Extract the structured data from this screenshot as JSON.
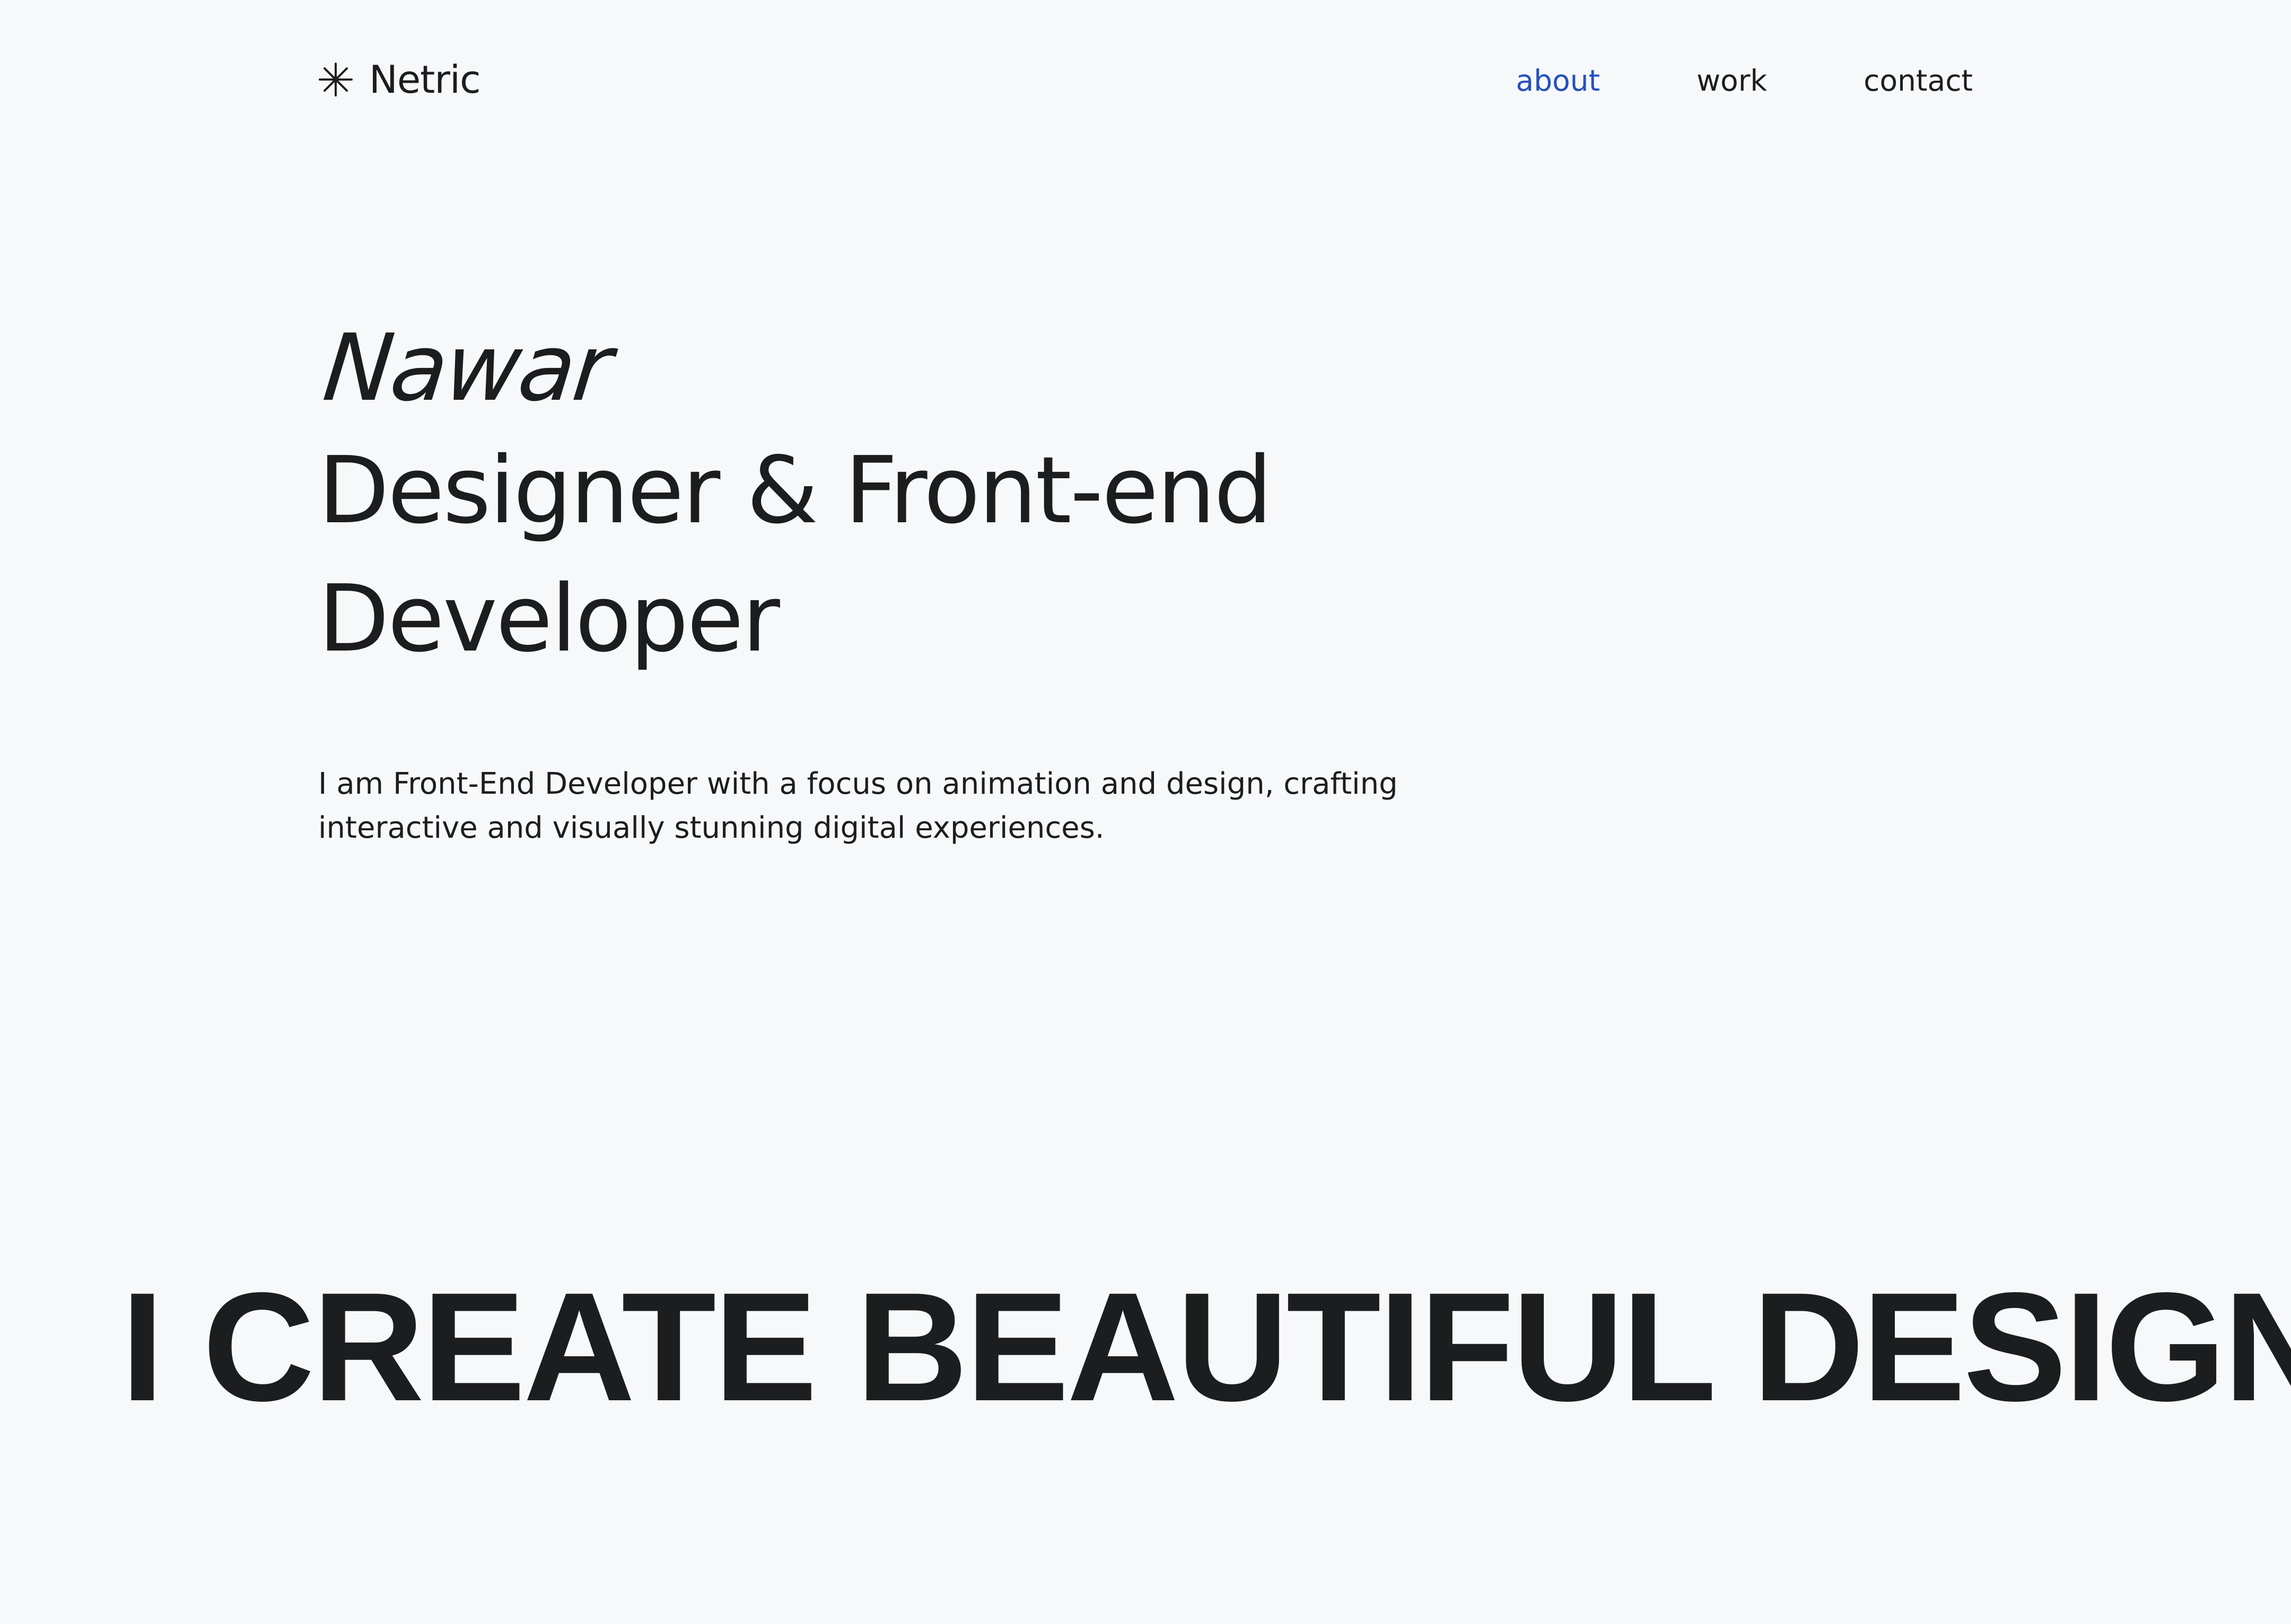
{
  "header": {
    "logo_text": "Netric",
    "logo_icon": "asterisk-star-icon",
    "nav": [
      {
        "label": "about",
        "active": true
      },
      {
        "label": "work",
        "active": false
      },
      {
        "label": "contact",
        "active": false
      }
    ]
  },
  "hero": {
    "name": "Nawar",
    "role_line1": "Designer & Front-end",
    "role_line2": "Developer",
    "description": "I am Front-End Developer with a focus on animation and design, crafting interactive and visually stunning digital experiences."
  },
  "marquee": {
    "text": "I CREATE BEAUTIFUL DESIGNS THAT"
  },
  "colors": {
    "background": "#f7f8fa",
    "text": "#1c1d1f",
    "accent": "#2550bf"
  }
}
